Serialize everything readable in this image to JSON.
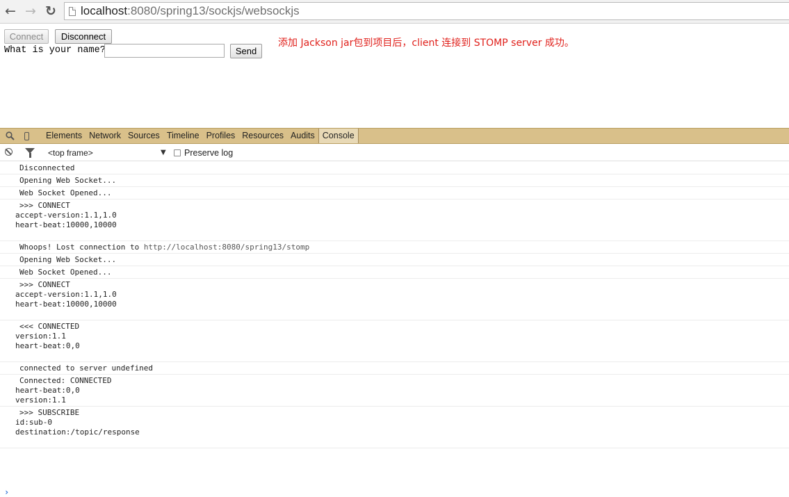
{
  "browser": {
    "url_host": "localhost",
    "url_rest": ":8080/spring13/sockjs/websockjs"
  },
  "page": {
    "connect_label": "Connect",
    "disconnect_label": "Disconnect",
    "name_prompt": "What is your name?",
    "name_value": "",
    "send_label": "Send",
    "note": "添加 Jackson jar包到项目后，client 连接到 STOMP server 成功。"
  },
  "devtools": {
    "tabs": [
      "Elements",
      "Network",
      "Sources",
      "Timeline",
      "Profiles",
      "Resources",
      "Audits",
      "Console"
    ],
    "active_tab": "Console",
    "frame": "<top frame>",
    "preserve_log": "Preserve log",
    "log": [
      {
        "text": "Disconnected"
      },
      {
        "text": "Opening Web Socket..."
      },
      {
        "text": "Web Socket Opened..."
      },
      {
        "text": ">>> CONNECT",
        "extra": "accept-version:1.1,1.0\nheart-beat:10000,10000\n\n"
      },
      {
        "text": "Whoops! Lost connection to ",
        "link": "http://localhost:8080/spring13/stomp"
      },
      {
        "text": "Opening Web Socket..."
      },
      {
        "text": "Web Socket Opened..."
      },
      {
        "text": ">>> CONNECT",
        "extra": "accept-version:1.1,1.0\nheart-beat:10000,10000\n\n"
      },
      {
        "text": "<<< CONNECTED",
        "extra": "version:1.1\nheart-beat:0,0\n\n"
      },
      {
        "text": "connected to server undefined"
      },
      {
        "text": "Connected: CONNECTED",
        "extra": "heart-beat:0,0\nversion:1.1\n"
      },
      {
        "text": ">>> SUBSCRIBE",
        "extra": "id:sub-0\ndestination:/topic/response\n\n"
      }
    ]
  }
}
